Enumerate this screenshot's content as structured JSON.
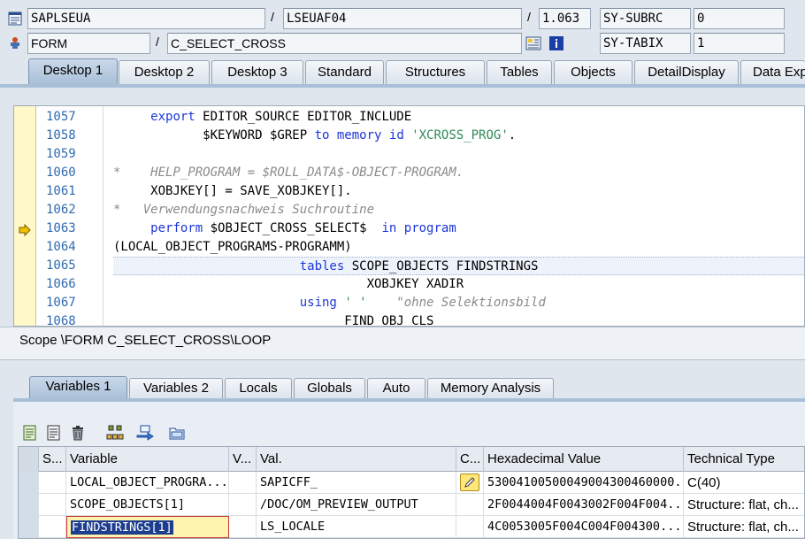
{
  "header": {
    "program": "SAPLSEUA",
    "include": "LSEUAF04",
    "line": "1.063",
    "sy_subrc_label": "SY-SUBRC",
    "sy_subrc_value": "0",
    "event_type": "FORM",
    "event_name": "C_SELECT_CROSS",
    "sy_tabix_label": "SY-TABIX",
    "sy_tabix_value": "1"
  },
  "desktop_tabs": [
    "Desktop 1",
    "Desktop 2",
    "Desktop 3",
    "Standard",
    "Structures",
    "Tables",
    "Objects",
    "DetailDisplay",
    "Data Exp"
  ],
  "editor": {
    "line_numbers": [
      "1057",
      "1058",
      "1059",
      "1060",
      "1061",
      "1062",
      "1063",
      "1064",
      "1065",
      "1066",
      "1067",
      "1068"
    ],
    "lines": [
      [
        {
          "t": "     "
        },
        {
          "t": "export",
          "c": "kw"
        },
        {
          "t": " EDITOR_SOURCE EDITOR_INCLUDE"
        }
      ],
      [
        {
          "t": "            $KEYWORD $GREP "
        },
        {
          "t": "to",
          "c": "kw"
        },
        {
          "t": " "
        },
        {
          "t": "memory",
          "c": "kw"
        },
        {
          "t": " "
        },
        {
          "t": "id",
          "c": "kw"
        },
        {
          "t": " "
        },
        {
          "t": "'XCROSS_PROG'",
          "c": "str"
        },
        {
          "t": "."
        }
      ],
      [
        {
          "t": ""
        }
      ],
      [
        {
          "t": "*    HELP_PROGRAM = $ROLL_DATA$-OBJECT-PROGRAM.",
          "c": "cmt"
        }
      ],
      [
        {
          "t": "     XOBJKEY[] = SAVE_XOBJKEY[]."
        }
      ],
      [
        {
          "t": "*   Verwendungsnachweis Suchroutine",
          "c": "cmt"
        }
      ],
      [
        {
          "t": "     "
        },
        {
          "t": "perform",
          "c": "kw"
        },
        {
          "t": " $OBJECT_CROSS_SELECT$  "
        },
        {
          "t": "in",
          "c": "kw"
        },
        {
          "t": " "
        },
        {
          "t": "program",
          "c": "kw"
        }
      ],
      [
        {
          "t": "(LOCAL_OBJECT_PROGRAMS-PROGRAMM)"
        }
      ],
      [
        {
          "t": "                         "
        },
        {
          "t": "tables",
          "c": "kw"
        },
        {
          "t": " SCOPE_OBJECTS FINDSTRINGS"
        }
      ],
      [
        {
          "t": "                                  XOBJKEY XADIR"
        }
      ],
      [
        {
          "t": "                         "
        },
        {
          "t": "using",
          "c": "kw"
        },
        {
          "t": " "
        },
        {
          "t": "' '",
          "c": "str"
        },
        {
          "t": "    "
        },
        {
          "t": "\"ohne Selektionsbild",
          "c": "cmt"
        }
      ],
      [
        {
          "t": "                               FIND_OBJ_CLS"
        }
      ]
    ]
  },
  "scope": "Scope \\FORM C_SELECT_CROSS\\LOOP",
  "variable_tabs": [
    "Variables 1",
    "Variables 2",
    "Locals",
    "Globals",
    "Auto",
    "Memory Analysis"
  ],
  "toolbar_icons": [
    "detail-view-icon",
    "list-view-icon",
    "delete-icon",
    "hierarchy-icon",
    "transfer-icon",
    "folder-icon"
  ],
  "grid": {
    "headers": [
      "S...",
      "Variable",
      "V...",
      "Val.",
      "C...",
      "Hexadecimal Value",
      "Technical Type"
    ],
    "rows": [
      {
        "variable": "LOCAL_OBJECT_PROGRA...",
        "val": "SAPICFF_",
        "hex": "53004100500049004300460000...",
        "type": "C(40)"
      },
      {
        "variable": "SCOPE_OBJECTS[1]",
        "val": "/DOC/OM_PREVIEW_OUTPUT",
        "hex": "2F0044004F0043002F004F004...",
        "type": "Structure: flat, ch..."
      },
      {
        "variable": "FINDSTRINGS[1]",
        "val": "LS_LOCALE",
        "hex": "4C0053005F004C004F004300...",
        "type": "Structure: flat, ch..."
      }
    ]
  }
}
